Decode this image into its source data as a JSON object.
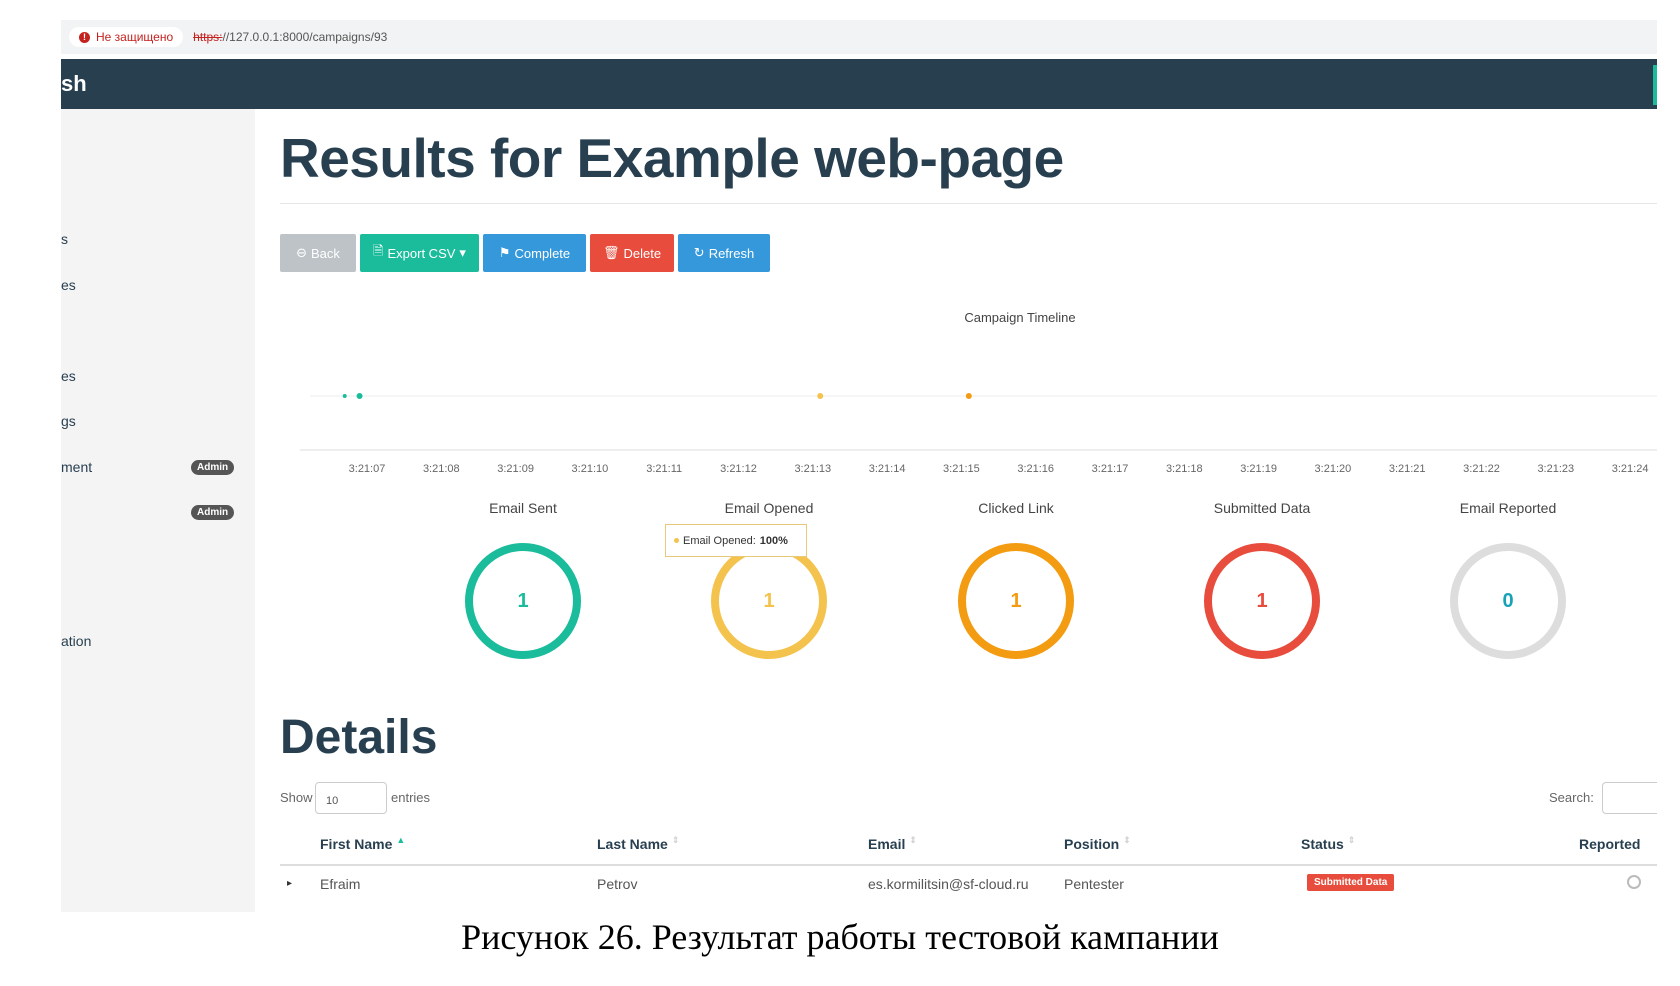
{
  "browser": {
    "security_label": "Не защищено",
    "url_scheme": "https:",
    "url_rest": "//127.0.0.1:8000/campaigns/93"
  },
  "navbar": {
    "brand_fragment": "sh"
  },
  "sidebar": {
    "items": [
      "s",
      "es",
      "es",
      "gs",
      "ment",
      "ation"
    ],
    "admin_badge": "Admin"
  },
  "page": {
    "title": "Results for Example web-page"
  },
  "toolbar": {
    "back": "Back",
    "export": "Export CSV",
    "complete": "Complete",
    "delete": "Delete",
    "refresh": "Refresh"
  },
  "timeline": {
    "title": "Campaign Timeline",
    "ticks": [
      "3:21:07",
      "3:21:08",
      "3:21:09",
      "3:21:10",
      "3:21:11",
      "3:21:12",
      "3:21:13",
      "3:21:14",
      "3:21:15",
      "3:21:16",
      "3:21:17",
      "3:21:18",
      "3:21:19",
      "3:21:20",
      "3:21:21",
      "3:21:22",
      "3:21:23",
      "3:21:24"
    ],
    "events": [
      {
        "time": "3:21:06.7",
        "color": "#1abc9c"
      },
      {
        "time": "3:21:06.9",
        "color": "#1abc9c"
      },
      {
        "time": "3:21:13.1",
        "color": "#f4c34d"
      },
      {
        "time": "3:21:15.1",
        "color": "#f39c12"
      }
    ]
  },
  "stats": [
    {
      "label": "Email Sent",
      "value": "1",
      "color": "#1abc9c"
    },
    {
      "label": "Email Opened",
      "value": "1",
      "color": "#f4c34d"
    },
    {
      "label": "Clicked Link",
      "value": "1",
      "color": "#f39c12"
    },
    {
      "label": "Submitted Data",
      "value": "1",
      "color": "#e74c3c"
    },
    {
      "label": "Email Reported",
      "value": "0",
      "color": "#dddddd",
      "text_color": "#17a2b8"
    }
  ],
  "tooltip": {
    "label": "Email Opened:",
    "value": "100%"
  },
  "details": {
    "title": "Details",
    "show_label": "Show",
    "length_value": "10",
    "entries_label": "entries",
    "search_label": "Search:",
    "columns": [
      "First Name",
      "Last Name",
      "Email",
      "Position",
      "Status",
      "Reported"
    ],
    "rows": [
      {
        "first_name": "Efraim",
        "last_name": "Petrov",
        "email": "es.kormilitsin@sf-cloud.ru",
        "position": "Pentester",
        "status": "Submitted Data"
      }
    ]
  },
  "caption": "Рисунок 26. Результат работы тестовой кампании"
}
